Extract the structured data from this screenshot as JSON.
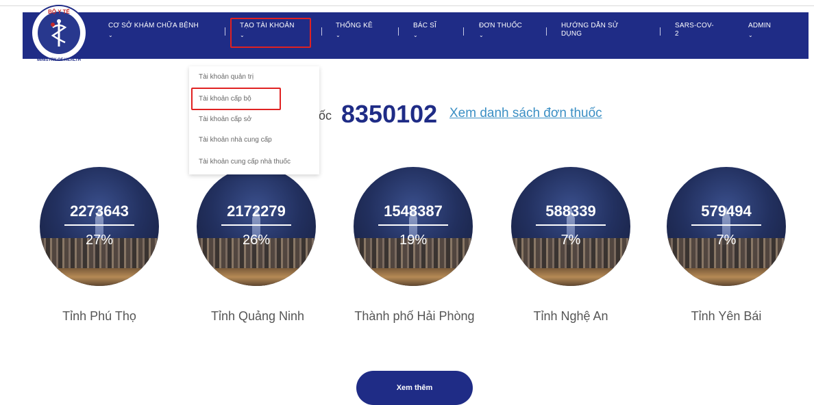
{
  "logo": {
    "top_text": "BỘ Y TẾ",
    "bottom_text": "MINISTRY OF HEALTH"
  },
  "nav": {
    "items": [
      {
        "label": "CƠ SỞ KHÁM CHỮA BỆNH",
        "label2": ""
      },
      {
        "label": "TẠO TÀI KHOẢN",
        "label2": ""
      },
      {
        "label": "THỐNG KÊ",
        "label2": ""
      },
      {
        "label": "BÁC SĨ",
        "label2": ""
      },
      {
        "label": "ĐƠN THUỐC",
        "label2": ""
      },
      {
        "label": "HƯỚNG DẪN SỬ",
        "label2": "DỤNG"
      },
      {
        "label": "SARS-COV-",
        "label2": "2"
      },
      {
        "label": "ADMIN",
        "label2": ""
      }
    ],
    "chevron": "⌄"
  },
  "dropdown": {
    "items": [
      "Tài khoản quản trị",
      "Tài khoản cấp bộ",
      "Tài khoản cấp sở",
      "Tài khoản nhà cung cấp",
      "Tài khoản cung cấp nhà thuốc"
    ]
  },
  "total": {
    "prefix": "uốc",
    "number": "8350102",
    "link": "Xem danh sách đơn thuốc"
  },
  "provinces": [
    {
      "count": "2273643",
      "percent": "27%",
      "name": "Tỉnh Phú Thọ"
    },
    {
      "count": "2172279",
      "percent": "26%",
      "name": "Tỉnh Quảng Ninh"
    },
    {
      "count": "1548387",
      "percent": "19%",
      "name": "Thành phố Hải Phòng"
    },
    {
      "count": "588339",
      "percent": "7%",
      "name": "Tỉnh Nghệ An"
    },
    {
      "count": "579494",
      "percent": "7%",
      "name": "Tỉnh Yên Bái"
    }
  ],
  "more_button": "Xem thêm",
  "colors": {
    "navy": "#1f2c86",
    "highlight": "#e02121",
    "link": "#3b8fc4"
  }
}
